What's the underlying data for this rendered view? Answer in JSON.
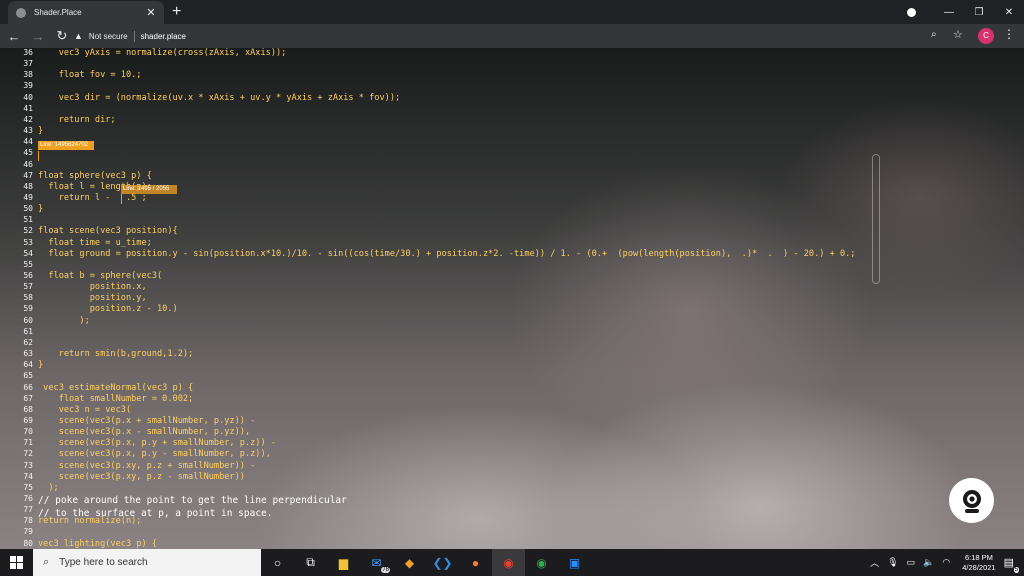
{
  "browser": {
    "tab_title": "Shader.Place",
    "tab_close": "✕",
    "new_tab": "+",
    "security_label": "Not secure",
    "url": "shader.place",
    "profile_initial": "C",
    "window_buttons": {
      "minimize": "—",
      "maximize": "❐",
      "close": "✕"
    }
  },
  "editor": {
    "error_label": "Line: 1495624702",
    "error_label_2": "Line: 1495 / 2055",
    "lines": [
      {
        "n": "36",
        "t": "    vec3 yAxis = normalize(cross(zAxis, xAxis));"
      },
      {
        "n": "37",
        "t": ""
      },
      {
        "n": "38",
        "t": "    float fov = 10.;"
      },
      {
        "n": "39",
        "t": ""
      },
      {
        "n": "40",
        "t": "    vec3 dir = (normalize(uv.x * xAxis + uv.y * yAxis + zAxis * fov));"
      },
      {
        "n": "41",
        "t": ""
      },
      {
        "n": "42",
        "t": "    return dir;"
      },
      {
        "n": "43",
        "t": "}"
      },
      {
        "n": "44",
        "t": ""
      },
      {
        "n": "45",
        "t": ""
      },
      {
        "n": "46",
        "t": ""
      },
      {
        "n": "47",
        "t": "float sphere(vec3 p) {"
      },
      {
        "n": "48",
        "t": "  float l = length(p);"
      },
      {
        "n": "49",
        "t": "    return l -   .5 ;"
      },
      {
        "n": "50",
        "t": "}"
      },
      {
        "n": "51",
        "t": ""
      },
      {
        "n": "52",
        "t": "float scene(vec3 position){"
      },
      {
        "n": "53",
        "t": "  float time = u_time;"
      },
      {
        "n": "54",
        "t": "  float ground = position.y - sin(position.x*10.)/10. - sin((cos(time/30.) + position.z*2. -time)) / 1. - (0.+  (pow(length(position),  .)*  .  ) - 20.) + 0.;"
      },
      {
        "n": "55",
        "t": ""
      },
      {
        "n": "56",
        "t": "  float b = sphere(vec3("
      },
      {
        "n": "57",
        "t": "          position.x,"
      },
      {
        "n": "58",
        "t": "          position.y,"
      },
      {
        "n": "59",
        "t": "          position.z - 10.)"
      },
      {
        "n": "60",
        "t": "        );"
      },
      {
        "n": "61",
        "t": ""
      },
      {
        "n": "62",
        "t": ""
      },
      {
        "n": "63",
        "t": "    return smin(b,ground,1.2);"
      },
      {
        "n": "64",
        "t": "}"
      },
      {
        "n": "65",
        "t": ""
      },
      {
        "n": "66",
        "t": " vec3 estimateNormal(vec3 p) {"
      },
      {
        "n": "67",
        "t": "    float smallNumber = 0.002;"
      },
      {
        "n": "68",
        "t": "    vec3 n = vec3("
      },
      {
        "n": "69",
        "t": "    scene(vec3(p.x + smallNumber, p.yz)) -"
      },
      {
        "n": "70",
        "t": "    scene(vec3(p.x - smallNumber, p.yz)),"
      },
      {
        "n": "71",
        "t": "    scene(vec3(p.x, p.y + smallNumber, p.z)) -"
      },
      {
        "n": "72",
        "t": "    scene(vec3(p.x, p.y - smallNumber, p.z)),"
      },
      {
        "n": "73",
        "t": "    scene(vec3(p.xy, p.z + smallNumber)) -"
      },
      {
        "n": "74",
        "t": "    scene(vec3(p.xy, p.z - smallNumber))"
      },
      {
        "n": "75",
        "t": "  );"
      },
      {
        "n": "76",
        "t": ""
      },
      {
        "n": "77",
        "t": ""
      },
      {
        "n": "78",
        "t": "return normalize(n);"
      },
      {
        "n": "79",
        "t": ""
      },
      {
        "n": "80",
        "t": "vec3 lighting(vec3 p) {"
      }
    ],
    "caption_line_1": "// poke around the point to get the line perpendicular",
    "caption_line_2": "// to the surface at p, a point in space."
  },
  "taskbar": {
    "search_placeholder": "Type here to search",
    "mail_badge": "78",
    "time": "6:18 PM",
    "date": "4/28/2021",
    "notification_count": "5"
  },
  "colors": {
    "code": "#ffd060",
    "error": "#f0a020",
    "taskbar": "#1c1c1f"
  }
}
